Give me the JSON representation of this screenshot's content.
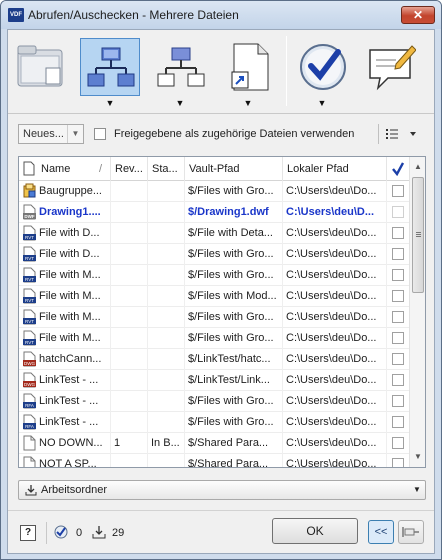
{
  "window": {
    "title": "Abrufen/Auschecken - Mehrere Dateien",
    "app_icon_text": "VDF",
    "close_label": "✕"
  },
  "toolbar": {
    "buttons": [
      {
        "name": "folder-view",
        "icon": "folder-icon"
      },
      {
        "name": "relationships",
        "icon": "hierarchy-icon",
        "active": true
      },
      {
        "name": "structure",
        "icon": "structure-icon"
      },
      {
        "name": "shortcut",
        "icon": "file-shortcut-icon"
      },
      {
        "name": "checkout",
        "icon": "checkmark-icon"
      },
      {
        "name": "comment",
        "icon": "comment-icon"
      }
    ],
    "dropdown_glyph": "▼"
  },
  "options": {
    "new_select_value": "Neues...",
    "shared_checkbox_label": "Freigegebene als zugehörige Dateien verwenden",
    "view_icon": "list-view-icon"
  },
  "grid": {
    "columns": [
      "Name",
      "Rev...",
      "Sta...",
      "Vault-Pfad",
      "Lokaler Pfad"
    ],
    "rows": [
      {
        "name": "Baugruppe...",
        "rev": "",
        "status": "",
        "vault": "$/Files with Gro...",
        "local": "C:\\Users\\deu\\Do...",
        "icon": "assembly",
        "bold": false
      },
      {
        "name": "Drawing1....",
        "rev": "",
        "status": "",
        "vault": "$/Drawing1.dwf",
        "local": "C:\\Users\\deu\\D...",
        "icon": "dwf",
        "bold": true
      },
      {
        "name": "File with D...",
        "rev": "",
        "status": "",
        "vault": "$/File with Deta...",
        "local": "C:\\Users\\deu\\Do...",
        "icon": "rvt",
        "bold": false
      },
      {
        "name": "File with D...",
        "rev": "",
        "status": "",
        "vault": "$/Files with Gro...",
        "local": "C:\\Users\\deu\\Do...",
        "icon": "rvt",
        "bold": false
      },
      {
        "name": "File with M...",
        "rev": "",
        "status": "",
        "vault": "$/Files with Gro...",
        "local": "C:\\Users\\deu\\Do...",
        "icon": "rvt",
        "bold": false
      },
      {
        "name": "File with M...",
        "rev": "",
        "status": "",
        "vault": "$/Files with Mod...",
        "local": "C:\\Users\\deu\\Do...",
        "icon": "rvt",
        "bold": false
      },
      {
        "name": "File with M...",
        "rev": "",
        "status": "",
        "vault": "$/Files with Gro...",
        "local": "C:\\Users\\deu\\Do...",
        "icon": "rvt",
        "bold": false
      },
      {
        "name": "File with M...",
        "rev": "",
        "status": "",
        "vault": "$/Files with Gro...",
        "local": "C:\\Users\\deu\\Do...",
        "icon": "rvt",
        "bold": false
      },
      {
        "name": "hatchCann...",
        "rev": "",
        "status": "",
        "vault": "$/LinkTest/hatc...",
        "local": "C:\\Users\\deu\\Do...",
        "icon": "dwg",
        "bold": false
      },
      {
        "name": "LinkTest - ...",
        "rev": "",
        "status": "",
        "vault": "$/LinkTest/Link...",
        "local": "C:\\Users\\deu\\Do...",
        "icon": "dwg",
        "bold": false
      },
      {
        "name": "LinkTest - ...",
        "rev": "",
        "status": "",
        "vault": "$/Files with Gro...",
        "local": "C:\\Users\\deu\\Do...",
        "icon": "rfa",
        "bold": false
      },
      {
        "name": "LinkTest - ...",
        "rev": "",
        "status": "",
        "vault": "$/Files with Gro...",
        "local": "C:\\Users\\deu\\Do...",
        "icon": "rfa",
        "bold": false
      },
      {
        "name": "NO DOWN...",
        "rev": "1",
        "status": "In B...",
        "vault": "$/Shared Para...",
        "local": "C:\\Users\\deu\\Do...",
        "icon": "doc",
        "bold": false
      },
      {
        "name": "NOT A SP...",
        "rev": "",
        "status": "",
        "vault": "$/Shared Para...",
        "local": "C:\\Users\\deu\\Do...",
        "icon": "doc",
        "bold": false
      }
    ]
  },
  "working_folder": {
    "label": "Arbeitsordner"
  },
  "footer": {
    "help_label": "?",
    "checked_count": "0",
    "download_count": "29",
    "ok_label": "OK",
    "collapse_label": "<<"
  }
}
